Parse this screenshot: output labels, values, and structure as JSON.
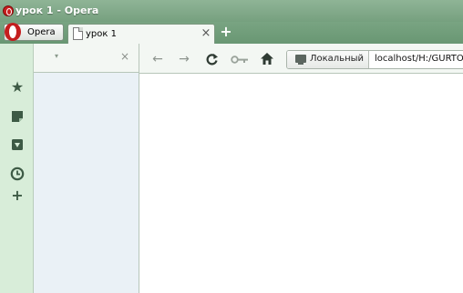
{
  "window": {
    "title": "урок 1 - Opera"
  },
  "opera_menu": {
    "label": "Opera"
  },
  "tabs": [
    {
      "title": "урок 1"
    }
  ],
  "panel": {
    "dropdown": "▾",
    "close": "×"
  },
  "address_bar": {
    "security_label": "Локальный",
    "url": "localhost/H:/GURTOM"
  },
  "icons": {
    "back": "back-arrow-icon",
    "forward": "forward-arrow-icon",
    "reload": "reload-icon",
    "key": "key-icon",
    "home": "home-icon",
    "bookmarks": "star-icon",
    "notes": "note-icon",
    "downloads": "download-icon",
    "history": "clock-icon",
    "add_panel": "plus-icon"
  },
  "colors": {
    "titlebar": "#7ea887",
    "tab_active": "#f3f7f3",
    "sidebar": "#d8edd9",
    "panel": "#eaf1f6"
  }
}
